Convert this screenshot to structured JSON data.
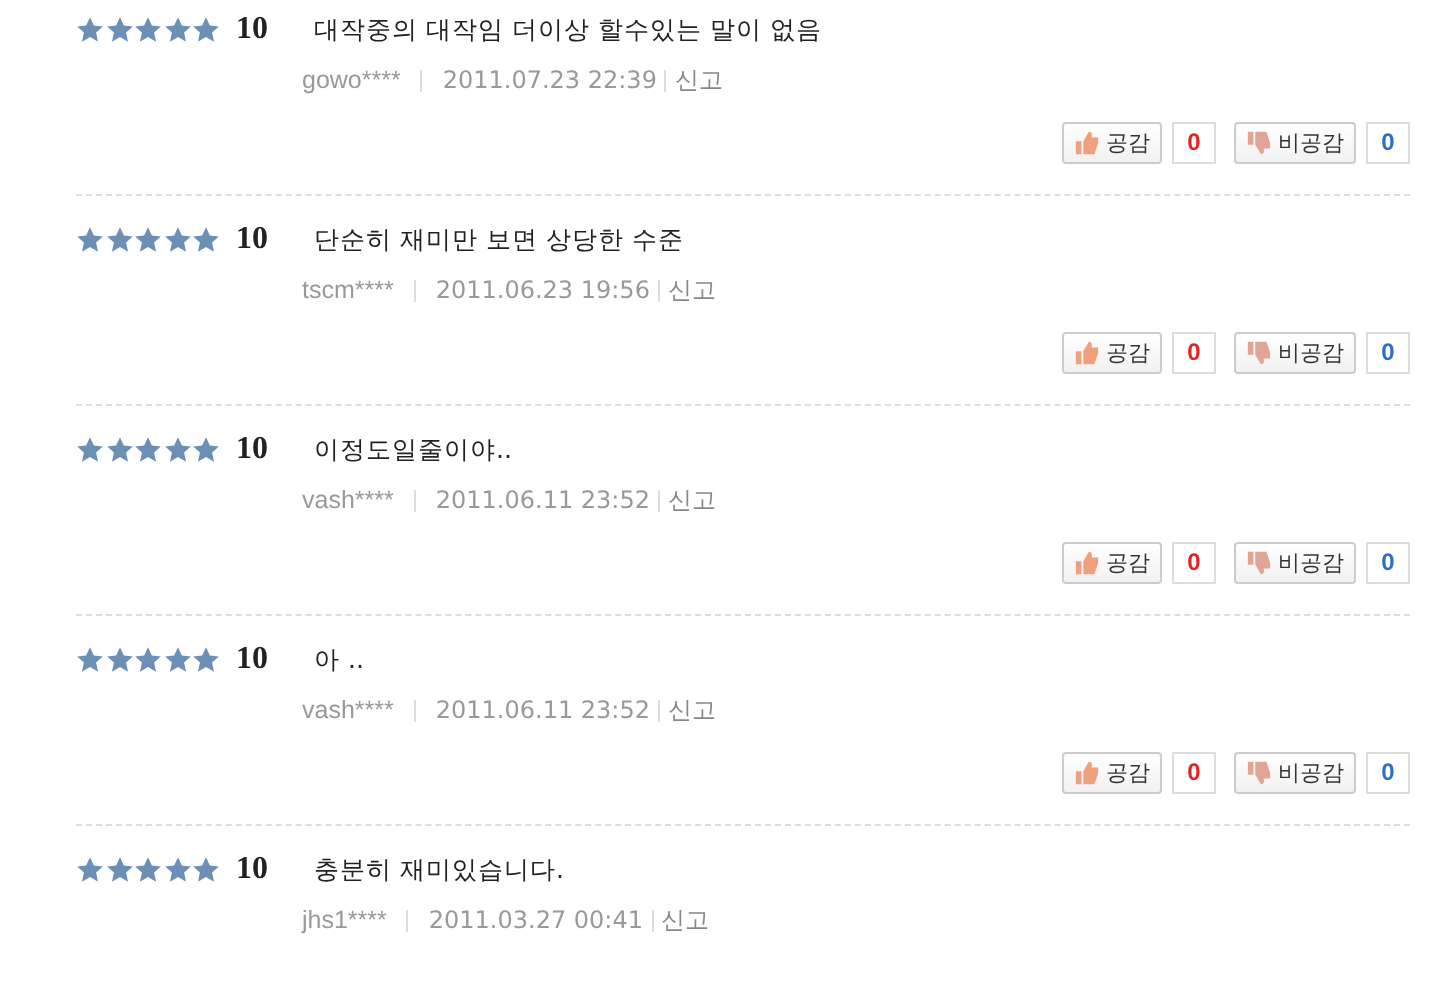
{
  "reviews": [
    {
      "stars": 5,
      "score": "10",
      "text": "대작중의 대작임 더이상 할수있는 말이 없음",
      "user": "gowo****",
      "date": "2011.07.23 22:39",
      "report": "신고",
      "like_label": "공감",
      "like_count": "0",
      "dislike_label": "비공감",
      "dislike_count": "0"
    },
    {
      "stars": 5,
      "score": "10",
      "text": "단순히 재미만 보면 상당한 수준",
      "user": "tscm****",
      "date": "2011.06.23 19:56",
      "report": "신고",
      "like_label": "공감",
      "like_count": "0",
      "dislike_label": "비공감",
      "dislike_count": "0"
    },
    {
      "stars": 5,
      "score": "10",
      "text": "이정도일줄이야..",
      "user": "vash****",
      "date": "2011.06.11 23:52",
      "report": "신고",
      "like_label": "공감",
      "like_count": "0",
      "dislike_label": "비공감",
      "dislike_count": "0"
    },
    {
      "stars": 5,
      "score": "10",
      "text": "아 ..",
      "user": "vash****",
      "date": "2011.06.11 23:52",
      "report": "신고",
      "like_label": "공감",
      "like_count": "0",
      "dislike_label": "비공감",
      "dislike_count": "0"
    },
    {
      "stars": 5,
      "score": "10",
      "text": "충분히 재미있습니다.",
      "user": "jhs1****",
      "date": "2011.03.27 00:41",
      "report": "신고"
    }
  ]
}
